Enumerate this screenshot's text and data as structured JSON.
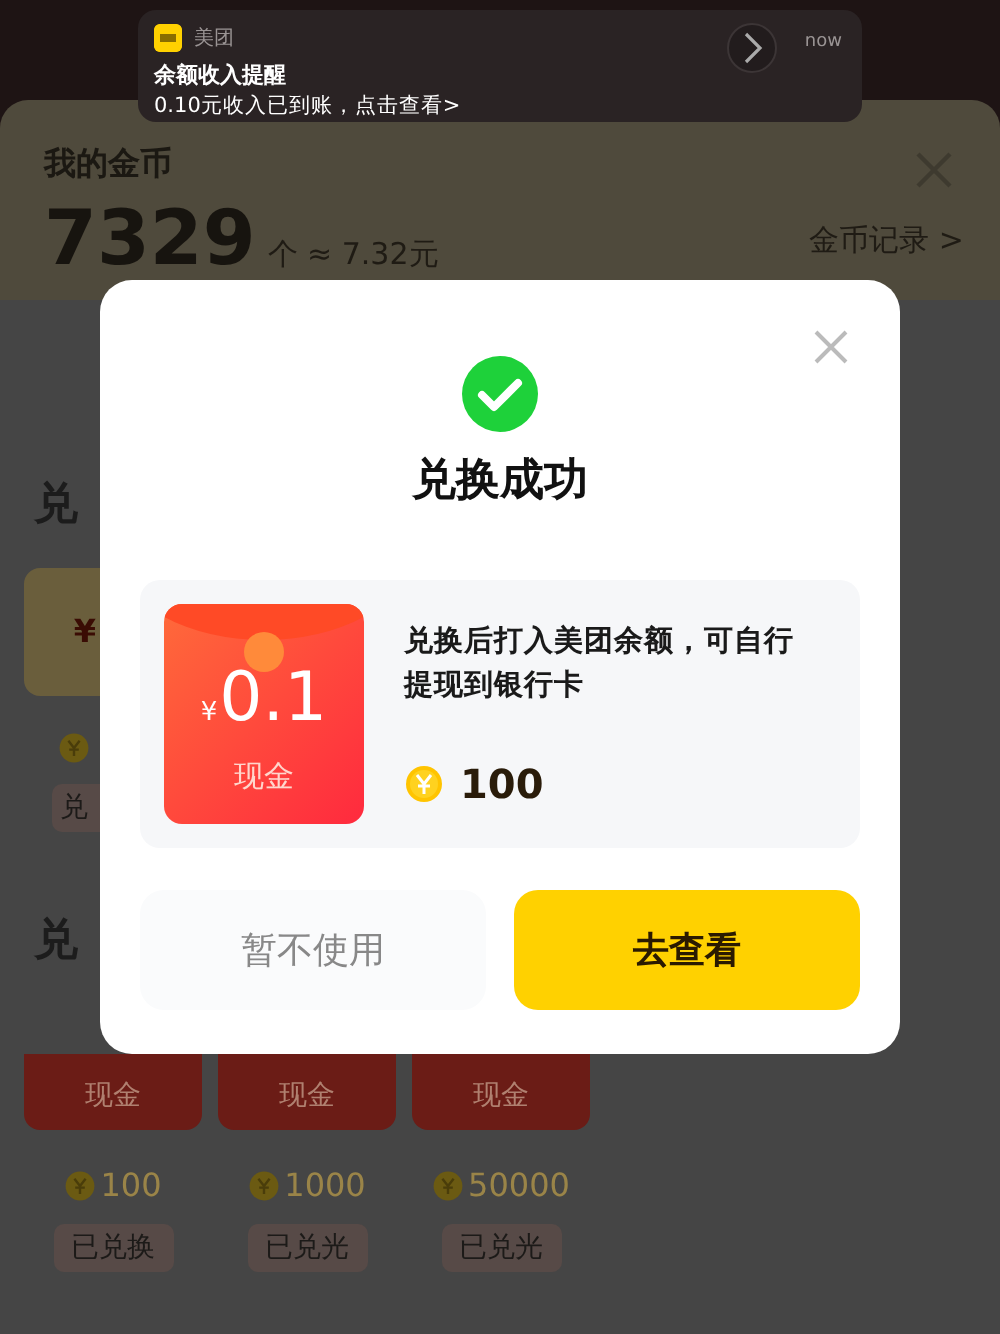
{
  "notification": {
    "app": "美团",
    "title": "余额收入提醒",
    "body": "0.10元收入已到账，点击查看>",
    "time": "now"
  },
  "coins": {
    "title": "我的金币",
    "amount": "7329",
    "unit": "个 ≈ 7.32元",
    "record_link": "金币记录 >"
  },
  "sections": [
    {
      "heading": "兑",
      "items": [
        {
          "kind": "partial",
          "currency": "¥",
          "button": "兑"
        }
      ]
    },
    {
      "heading": "兑",
      "items": [
        {
          "kind": "full",
          "label": "现金",
          "cost": "100",
          "button": "已兑换"
        },
        {
          "kind": "full",
          "label": "现金",
          "cost": "1000",
          "button": "已兑光"
        },
        {
          "kind": "full",
          "label": "现金",
          "cost": "50000",
          "button": "已兑光"
        }
      ]
    }
  ],
  "dialog": {
    "title": "兑换成功",
    "prize": {
      "currency": "¥",
      "amount": "0.1",
      "label": "现金"
    },
    "description": "兑换后打入美团余额，可自行提现到银行卡",
    "cost": "100",
    "buttons": [
      {
        "label": "暂不使用",
        "kind": "secondary"
      },
      {
        "label": "去查看",
        "kind": "primary"
      }
    ]
  }
}
